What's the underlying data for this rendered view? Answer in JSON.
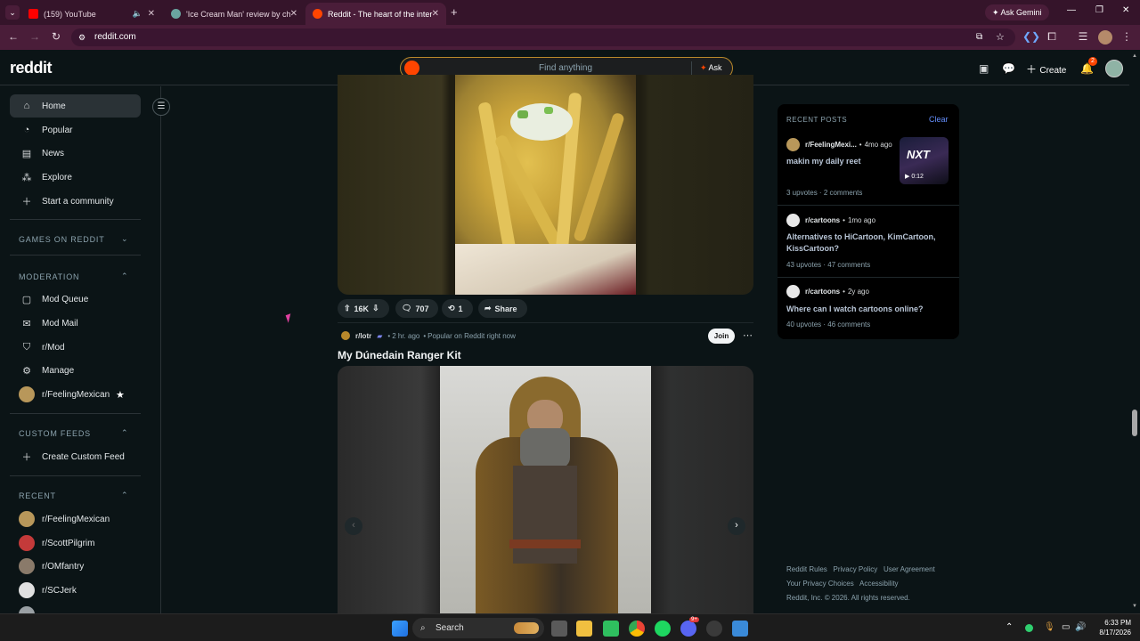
{
  "browser": {
    "tabs": [
      {
        "label": "(159) YouTube"
      },
      {
        "label": "'Ice Cream Man' review by chil"
      },
      {
        "label": "Reddit - The heart of the intern"
      }
    ],
    "url": "reddit.com",
    "ask_gemini": "Ask Gemini"
  },
  "header": {
    "logo": "reddit",
    "search_placeholder": "Find anything",
    "ask": "Ask",
    "create": "Create",
    "notif_count": "2"
  },
  "sidebar": {
    "main": [
      {
        "label": "Home",
        "icon": "home-icon"
      },
      {
        "label": "Popular",
        "icon": "popular-icon"
      },
      {
        "label": "News",
        "icon": "news-icon"
      },
      {
        "label": "Explore",
        "icon": "explore-icon"
      },
      {
        "label": "Start a community",
        "icon": "plus-icon"
      }
    ],
    "games_header": "GAMES ON REDDIT",
    "moderation_header": "MODERATION",
    "moderation": [
      {
        "label": "Mod Queue"
      },
      {
        "label": "Mod Mail"
      },
      {
        "label": "r/Mod"
      },
      {
        "label": "Manage"
      },
      {
        "label": "r/FeelingMexican"
      }
    ],
    "custom_header": "CUSTOM FEEDS",
    "custom": [
      {
        "label": "Create Custom Feed"
      }
    ],
    "recent_header": "RECENT",
    "recent": [
      {
        "label": "r/FeelingMexican"
      },
      {
        "label": "r/ScottPilgrim"
      },
      {
        "label": "r/OMfantry"
      },
      {
        "label": "r/SCJerk"
      }
    ]
  },
  "feed": {
    "post1_actions": {
      "votes": "16K",
      "comments": "707",
      "crossposts": "1",
      "share": "Share"
    },
    "post2": {
      "subreddit": "r/lotr",
      "time": "2 hr. ago",
      "popular": "Popular on Reddit right now",
      "join": "Join",
      "title": "My Dúnedain Ranger Kit"
    }
  },
  "recent_posts": {
    "title": "RECENT POSTS",
    "clear": "Clear",
    "items": [
      {
        "sub": "r/FeelingMexi...",
        "time": "4mo ago",
        "title": "makin my daily reet",
        "upvotes": "3 upvotes",
        "comments": "2 comments",
        "thumb_text": "NXT",
        "duration": "0:12"
      },
      {
        "sub": "r/cartoons",
        "time": "1mo ago",
        "title": "Alternatives to HiCartoon, KimCartoon, KissCartoon?",
        "upvotes": "43 upvotes",
        "comments": "47 comments"
      },
      {
        "sub": "r/cartoons",
        "time": "2y ago",
        "title": "Where can I watch cartoons online?",
        "upvotes": "40 upvotes",
        "comments": "46 comments"
      }
    ]
  },
  "footer": {
    "line1": [
      "Reddit Rules",
      "Privacy Policy",
      "User Agreement"
    ],
    "line2": [
      "Your Privacy Choices",
      "Accessibility"
    ],
    "line3": "Reddit, Inc. © 2026. All rights reserved."
  },
  "taskbar": {
    "search": "Search",
    "time": "6:33 PM",
    "date": "8/17/2026",
    "discord_badge": "9+"
  }
}
